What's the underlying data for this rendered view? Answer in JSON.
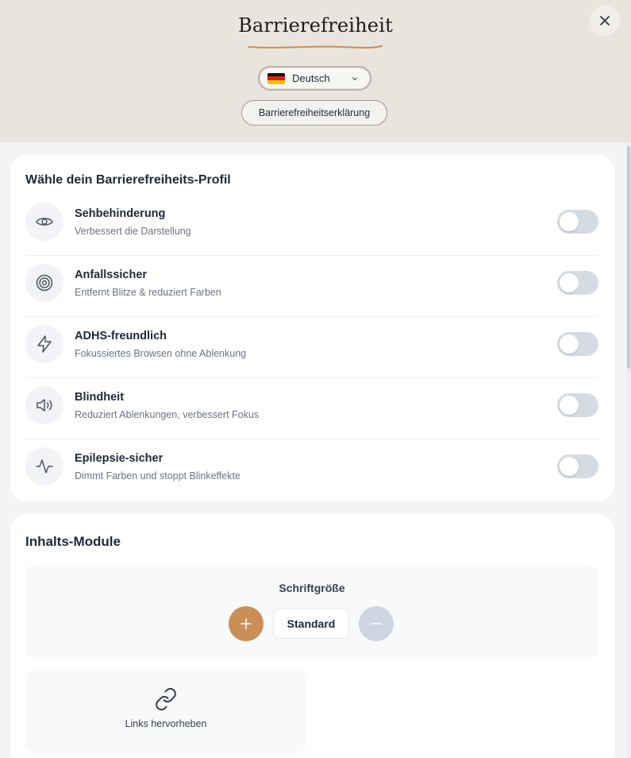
{
  "header": {
    "title": "Barrierefreiheit",
    "accent_color": "#c98f57",
    "close_icon": "close-icon",
    "language": {
      "selected": "Deutsch",
      "flag": "germany-flag-icon",
      "chevron": "chevron-down-icon"
    },
    "statement_button": "Barrierefreiheitserklärung"
  },
  "profiles": {
    "title": "Wähle dein Barrierefreiheits-Profil",
    "items": [
      {
        "name": "Sehbehinderung",
        "description": "Verbessert die Darstellung",
        "icon": "eye-icon",
        "enabled": false
      },
      {
        "name": "Anfallssicher",
        "description": "Entfernt Blitze & reduziert Farben",
        "icon": "target-icon",
        "enabled": false
      },
      {
        "name": "ADHS-freundlich",
        "description": "Fokussiertes Browsen ohne Ablenkung",
        "icon": "lightning-icon",
        "enabled": false
      },
      {
        "name": "Blindheit",
        "description": "Reduziert Ablenkungen, verbessert Fokus",
        "icon": "speaker-icon",
        "enabled": false
      },
      {
        "name": "Epilepsie-sicher",
        "description": "Dimmt Farben und stoppt Blinkeffekte",
        "icon": "pulse-icon",
        "enabled": false
      }
    ]
  },
  "content_modules": {
    "title": "Inhalts-Module",
    "font_size": {
      "label": "Schriftgröße",
      "value": "Standard",
      "increase_icon": "plus-icon",
      "decrease_icon": "minus-icon"
    },
    "highlight_links": {
      "label": "Links hervorheben",
      "icon": "link-icon"
    }
  }
}
